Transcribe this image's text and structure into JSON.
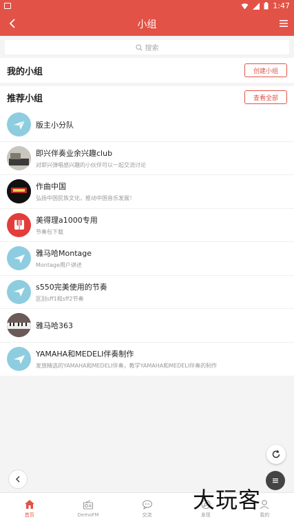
{
  "status_bar": {
    "time": "1:47"
  },
  "app_bar": {
    "title": "小组"
  },
  "search": {
    "placeholder": "搜索"
  },
  "my_groups": {
    "title": "我的小组",
    "create_label": "创建小组"
  },
  "recommended": {
    "title": "推荐小组",
    "view_all_label": "查看全部"
  },
  "groups": [
    {
      "name": "版主小分队",
      "desc": ""
    },
    {
      "name": "即兴伴奏业余兴趣club",
      "desc": "对即兴弹唱感兴趣的小伙伴可以一起交流讨论"
    },
    {
      "name": "作曲中国",
      "desc": "弘扬中国民族文化，推动中国音乐发展！"
    },
    {
      "name": "美得理a1000专用",
      "desc": "节奏包下载"
    },
    {
      "name": "雅马哈Montage",
      "desc": "Montage用户讲述"
    },
    {
      "name": "s550完美使用的节奏",
      "desc": "区别sff1和sff2节奏"
    },
    {
      "name": "雅马哈363",
      "desc": ""
    },
    {
      "name": "YAMAHA和MEDELI伴奏制作",
      "desc": "发放精选的YAMAHA和MEDELI伴奏，教学YAMAHA和MEDELI伴奏的制作"
    }
  ],
  "tabs": [
    {
      "label": "首页",
      "icon": "home-icon"
    },
    {
      "label": "DemoFM",
      "icon": "radio-icon"
    },
    {
      "label": "交流",
      "icon": "chat-icon"
    },
    {
      "label": "发现",
      "icon": "discover-icon"
    },
    {
      "label": "我的",
      "icon": "profile-icon"
    }
  ],
  "watermark": "大玩客",
  "colors": {
    "accent": "#e25246",
    "background": "#f4f4f4"
  }
}
